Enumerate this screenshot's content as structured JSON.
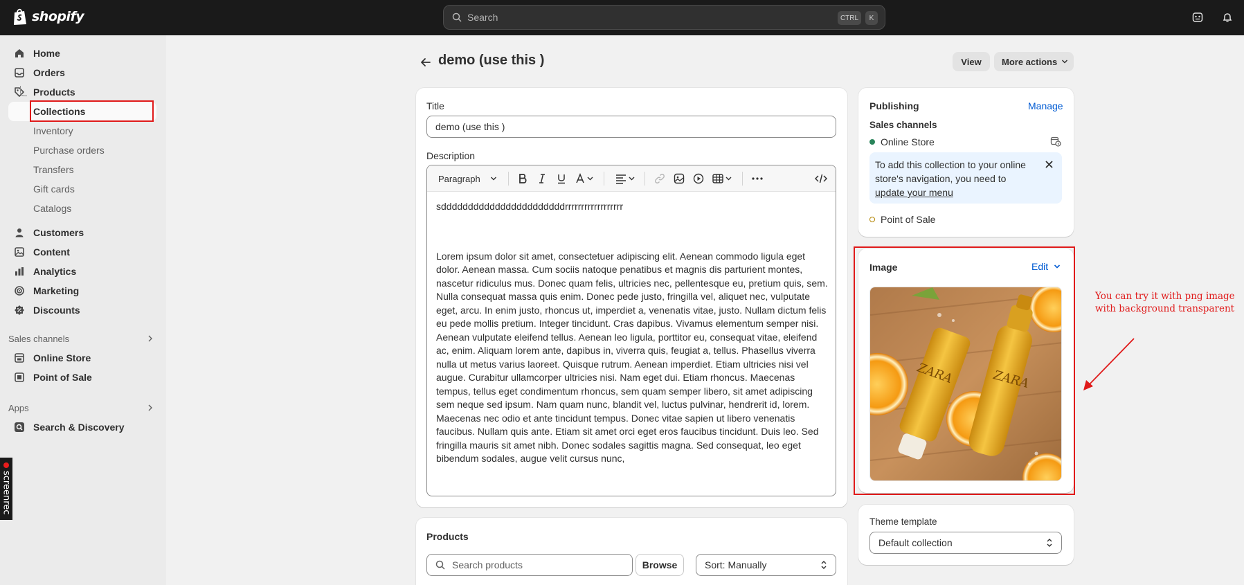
{
  "topbar": {
    "brand": "shopify",
    "search_placeholder": "Search",
    "kbd_ctrl": "CTRL",
    "kbd_k": "K"
  },
  "sidebar": {
    "main": [
      {
        "label": "Home",
        "icon": "home-icon"
      },
      {
        "label": "Orders",
        "icon": "inbox-icon"
      },
      {
        "label": "Products",
        "icon": "tag-icon"
      }
    ],
    "products_sub": [
      "Collections",
      "Inventory",
      "Purchase orders",
      "Transfers",
      "Gift cards",
      "Catalogs"
    ],
    "more": [
      {
        "label": "Customers",
        "icon": "person-icon"
      },
      {
        "label": "Content",
        "icon": "image-icon"
      },
      {
        "label": "Analytics",
        "icon": "chart-icon"
      },
      {
        "label": "Marketing",
        "icon": "target-icon"
      },
      {
        "label": "Discounts",
        "icon": "discount-icon"
      }
    ],
    "sales_channels_label": "Sales channels",
    "sales_channels": [
      {
        "label": "Online Store",
        "icon": "store-icon"
      },
      {
        "label": "Point of Sale",
        "icon": "pos-icon"
      }
    ],
    "apps_label": "Apps",
    "apps": [
      {
        "label": "Search & Discovery",
        "icon": "search-discovery-icon"
      }
    ],
    "screenrec": "screenrec"
  },
  "header": {
    "title": "demo (use this )",
    "view_label": "View",
    "more_actions_label": "More actions"
  },
  "details": {
    "title_label": "Title",
    "title_value": "demo (use this )",
    "description_label": "Description",
    "paragraph_label": "Paragraph",
    "first_line": "sdddddddddddddddddddddddrrrrrrrrrrrrrrrrrr",
    "body": "Lorem ipsum dolor sit amet, consectetuer adipiscing elit. Aenean commodo ligula eget dolor. Aenean massa. Cum sociis natoque penatibus et magnis dis parturient montes, nascetur ridiculus mus. Donec quam felis, ultricies nec, pellentesque eu, pretium quis, sem. Nulla consequat massa quis enim. Donec pede justo, fringilla vel, aliquet nec, vulputate eget, arcu. In enim justo, rhoncus ut, imperdiet a, venenatis vitae, justo. Nullam dictum felis eu pede mollis pretium. Integer tincidunt. Cras dapibus. Vivamus elementum semper nisi. Aenean vulputate eleifend tellus. Aenean leo ligula, porttitor eu, consequat vitae, eleifend ac, enim. Aliquam lorem ante, dapibus in, viverra quis, feugiat a, tellus. Phasellus viverra nulla ut metus varius laoreet. Quisque rutrum. Aenean imperdiet. Etiam ultricies nisi vel augue. Curabitur ullamcorper ultricies nisi. Nam eget dui. Etiam rhoncus. Maecenas tempus, tellus eget condimentum rhoncus, sem quam semper libero, sit amet adipiscing sem neque sed ipsum. Nam quam nunc, blandit vel, luctus pulvinar, hendrerit id, lorem. Maecenas nec odio et ante tincidunt tempus. Donec vitae sapien ut libero venenatis faucibus. Nullam quis ante. Etiam sit amet orci eget eros faucibus tincidunt. Duis leo. Sed fringilla mauris sit amet nibh. Donec sodales sagittis magna. Sed consequat, leo eget bibendum sodales, augue velit cursus nunc,"
  },
  "products": {
    "title": "Products",
    "search_placeholder": "Search products",
    "browse_label": "Browse",
    "sort_label": "Sort: Manually"
  },
  "publishing": {
    "title": "Publishing",
    "manage_label": "Manage",
    "sales_channels_label": "Sales channels",
    "online_store": "Online Store",
    "banner_text": "To add this collection to your online store's navigation, you need to",
    "banner_link": "update your menu",
    "point_of_sale": "Point of Sale",
    "colors": {
      "active": "#29845a",
      "inactive": "#b28400"
    }
  },
  "image_card": {
    "title": "Image",
    "edit_label": "Edit",
    "brand_on_product": "ZARA"
  },
  "annotation": {
    "note": "You can try it with png image with background transparent",
    "color": "#e01a1a"
  },
  "theme": {
    "label": "Theme template",
    "value": "Default collection"
  }
}
